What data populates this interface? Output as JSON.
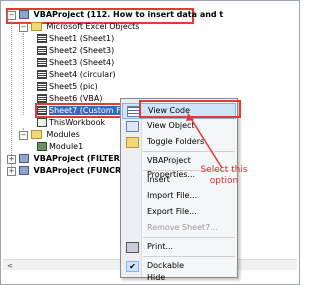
{
  "tree": {
    "project1": "VBAProject (112. How to insert data and t",
    "excel_objects": "Microsoft Excel Objects",
    "sheets": [
      "Sheet1 (Sheet1)",
      "Sheet2 (Sheet3)",
      "Sheet3 (Sheet4)",
      "Sheet4 (circular)",
      "Sheet5 (pic)",
      "Sheet6 (VBA)",
      "Sheet7 (Custom Function)"
    ],
    "thisworkbook": "ThisWorkbook",
    "modules": "Modules",
    "module1": "Module1",
    "project2": "VBAProject (FILTER Add",
    "project3": "VBAProject (FUNCRES.XL"
  },
  "menu": {
    "items": [
      {
        "label": "View Code",
        "icon": "code-icon",
        "hover": true
      },
      {
        "label": "View Object",
        "icon": "object-icon"
      },
      {
        "label": "Toggle Folders",
        "icon": "folder-icon"
      },
      {
        "label": "VBAProject Properties..."
      },
      {
        "label": "Insert"
      },
      {
        "label": "Import File..."
      },
      {
        "label": "Export File..."
      },
      {
        "label": "Remove Sheet7...",
        "disabled": true
      },
      {
        "label": "Print...",
        "icon": "print-icon"
      },
      {
        "label": "Dockable",
        "icon": "check-icon"
      },
      {
        "label": "Hide"
      }
    ]
  },
  "annotation": {
    "text": "Select this option"
  },
  "scrollbar": {
    "left_arrow": "<"
  },
  "colors": {
    "highlight_box": "#e53935",
    "selection": "#316ac5",
    "menu_hover": "#cfe4fb"
  }
}
